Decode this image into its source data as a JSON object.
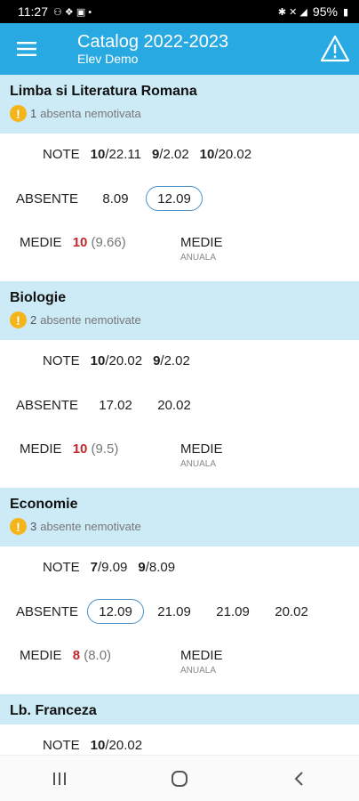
{
  "status_bar": {
    "time": "11:27",
    "battery": "95%"
  },
  "app_bar": {
    "title": "Catalog 2022-2023",
    "subtitle": "Elev Demo"
  },
  "labels": {
    "grades": "NOTE",
    "absences": "ABSENTE",
    "average": "MEDIE",
    "annual": "ANUALA"
  },
  "subjects": [
    {
      "name": "Limba si Literatura Romana",
      "unexcused_count": "1",
      "unexcused_text": "absenta nemotivata",
      "grades": [
        {
          "value": "10",
          "date": "/22.11"
        },
        {
          "value": "9",
          "date": "/2.02"
        },
        {
          "value": "10",
          "date": "/20.02"
        }
      ],
      "absences": [
        "8.09",
        "12.09"
      ],
      "average": "10",
      "average_exact": "(9.66)"
    },
    {
      "name": "Biologie",
      "unexcused_count": "2",
      "unexcused_text": "absente nemotivate",
      "grades": [
        {
          "value": "10",
          "date": "/20.02"
        },
        {
          "value": "9",
          "date": "/2.02"
        }
      ],
      "absences": [
        "17.02",
        "20.02"
      ],
      "average": "10",
      "average_exact": "(9.5)"
    },
    {
      "name": "Economie",
      "unexcused_count": "3",
      "unexcused_text": "absente nemotivate",
      "grades": [
        {
          "value": "7",
          "date": "/9.09"
        },
        {
          "value": "9",
          "date": "/8.09"
        }
      ],
      "absences": [
        "12.09",
        "21.09",
        "21.09",
        "20.02"
      ],
      "average": "8",
      "average_exact": "(8.0)"
    },
    {
      "name": "Lb. Franceza",
      "grades": [
        {
          "value": "10",
          "date": "/20.02"
        }
      ]
    }
  ],
  "colors": {
    "app_bar": "#29a9e1",
    "subject_header": "#cdeaf7",
    "average": "#c0262c",
    "warning": "#f4b41a"
  }
}
